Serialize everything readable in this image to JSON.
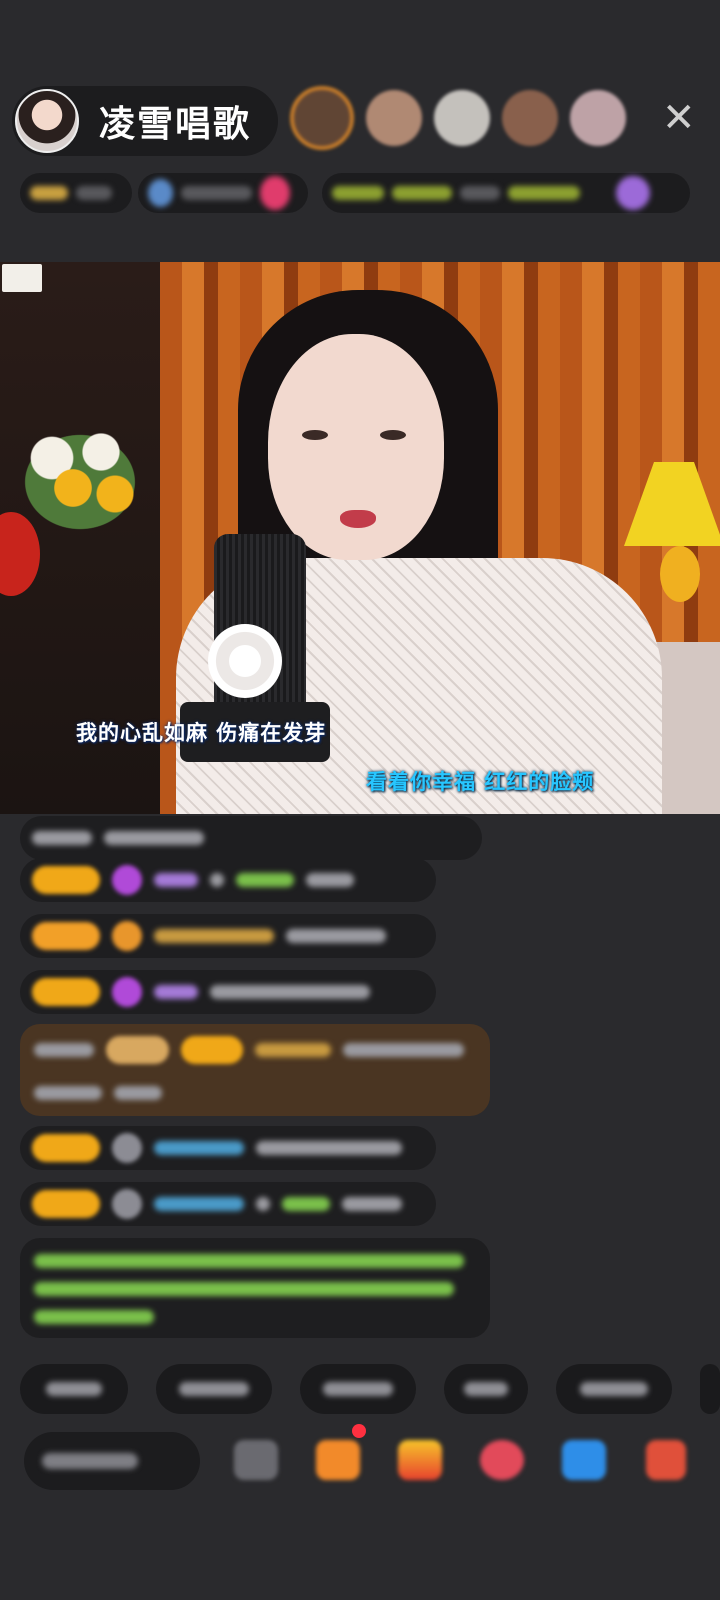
{
  "host": {
    "name": "凌雪唱歌"
  },
  "close_icon": "✕",
  "video": {
    "lyrics_line1": "我的心乱如麻  伤痛在发芽",
    "lyrics_line2": "看着你幸福  红红的脸颊"
  },
  "icons": {
    "close": "close-icon",
    "emoji": "emoji-icon",
    "gift_box": "gift-box-icon",
    "ticket": "ticket-icon",
    "heart": "heart-icon",
    "game": "game-controller-icon",
    "shop": "shop-icon"
  },
  "colors": {
    "background": "#2a2a2d",
    "level_badge": "#f0a818",
    "lyric_highlight": "#27c6ff",
    "notification_dot": "#ff3040",
    "gift_message_bg": "#4a3522"
  }
}
